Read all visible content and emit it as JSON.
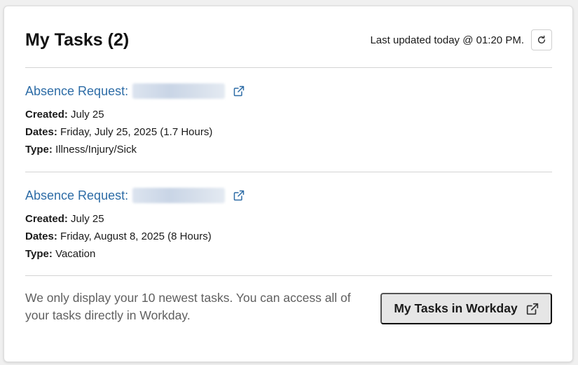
{
  "header": {
    "title": "My Tasks (2)",
    "last_updated": "Last updated today @ 01:20 PM."
  },
  "tasks": [
    {
      "link_label": "Absence Request:",
      "created_label": "Created:",
      "created_value": "July 25",
      "dates_label": "Dates:",
      "dates_value": "Friday, July 25, 2025 (1.7 Hours)",
      "type_label": "Type:",
      "type_value": "Illness/Injury/Sick"
    },
    {
      "link_label": "Absence Request:",
      "created_label": "Created:",
      "created_value": "July 25",
      "dates_label": "Dates:",
      "dates_value": "Friday, August 8, 2025 (8 Hours)",
      "type_label": "Type:",
      "type_value": "Vacation"
    }
  ],
  "footer": {
    "note": "We only display your 10 newest tasks. You can access all of your tasks directly in Workday.",
    "button_label": "My Tasks in Workday"
  },
  "colors": {
    "link": "#2d6ca6",
    "button_bg": "#e6e6e6"
  },
  "icons": {
    "refresh": "refresh-icon",
    "external_link": "external-link-icon"
  }
}
